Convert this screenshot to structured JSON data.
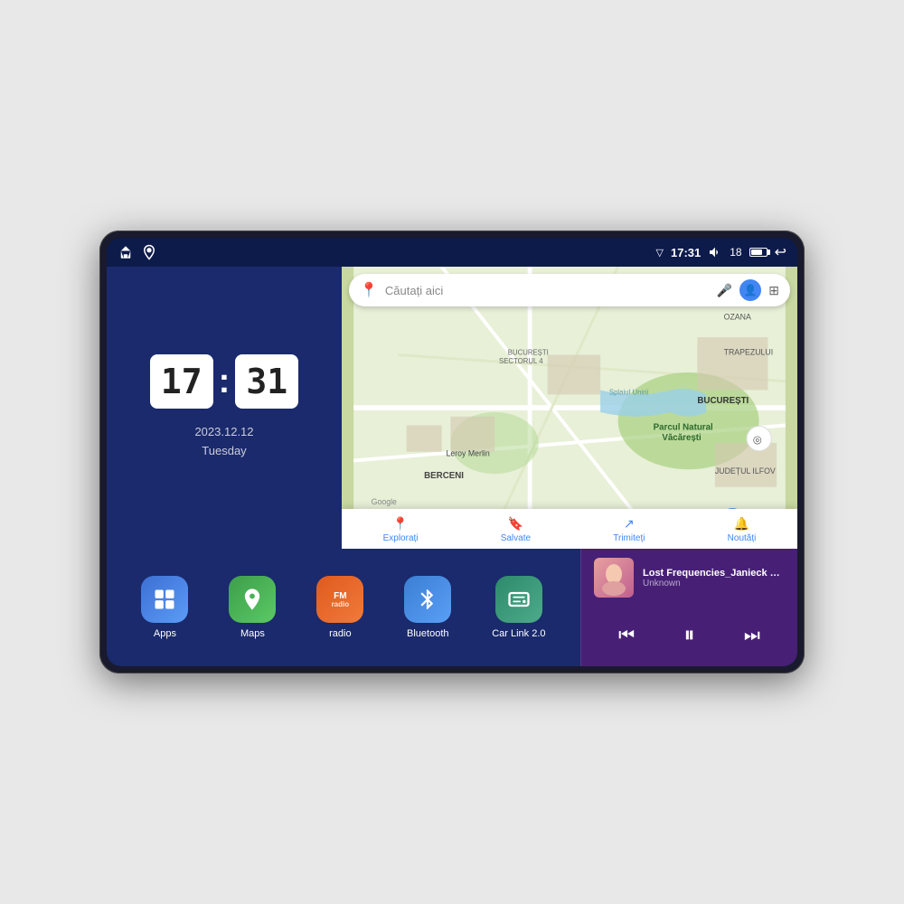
{
  "device": {
    "status_bar": {
      "time": "17:31",
      "signal": "▽",
      "volume": "🔊",
      "battery_pct": "18",
      "nav_back": "↩"
    },
    "clock": {
      "hours": "17",
      "minutes": "31",
      "date": "2023.12.12",
      "day": "Tuesday"
    },
    "map": {
      "search_placeholder": "Căutați aici",
      "nav_items": [
        {
          "label": "Explorați",
          "active": true
        },
        {
          "label": "Salvate",
          "active": false
        },
        {
          "label": "Trimiteți",
          "active": false
        },
        {
          "label": "Noutăți",
          "active": false
        }
      ],
      "places": [
        "Parcul Natural Văcărești",
        "Leroy Merlin",
        "BUCUREȘTI",
        "JUDEȚUL ILFOV",
        "BERCENI",
        "TRAPEZULUI",
        "OZANA"
      ]
    },
    "apps": [
      {
        "id": "apps",
        "label": "Apps",
        "bg": "apps-bg",
        "icon": "⊞"
      },
      {
        "id": "maps",
        "label": "Maps",
        "bg": "maps-bg",
        "icon": "📍"
      },
      {
        "id": "radio",
        "label": "radio",
        "bg": "radio-bg",
        "icon": "FM"
      },
      {
        "id": "bluetooth",
        "label": "Bluetooth",
        "bg": "bt-bg",
        "icon": "⚡"
      },
      {
        "id": "carlink",
        "label": "Car Link 2.0",
        "bg": "carlink-bg",
        "icon": "🔗"
      }
    ],
    "music": {
      "title": "Lost Frequencies_Janieck Devy-...",
      "artist": "Unknown",
      "controls": {
        "prev": "⏮",
        "play_pause": "⏸",
        "next": "⏭"
      }
    }
  }
}
